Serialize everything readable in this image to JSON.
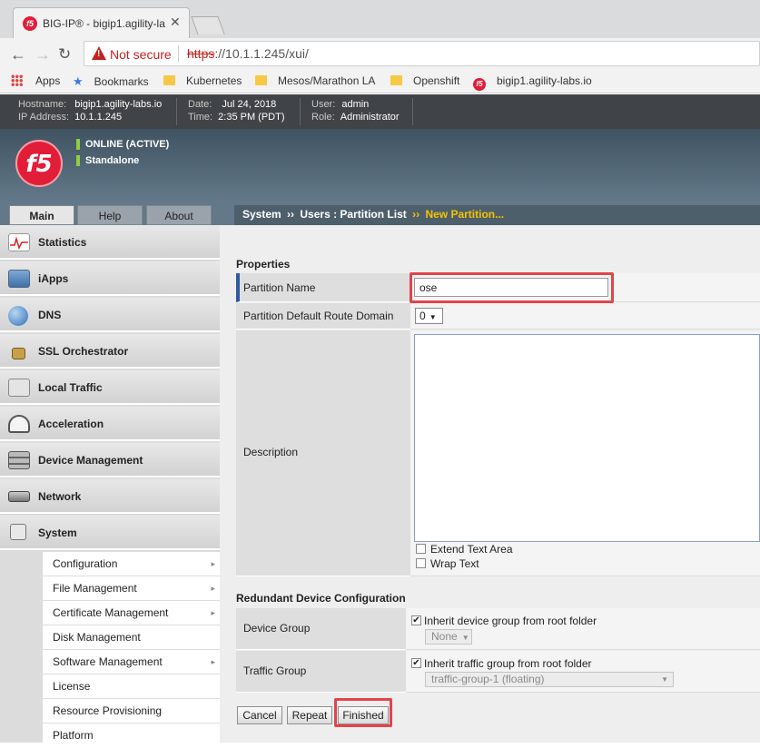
{
  "browser": {
    "tab_title": "BIG-IP® - bigip1.agility-la",
    "url_warning": "Not secure",
    "url_protocol": "https",
    "url_rest": "://10.1.1.245/xui/",
    "bookmarks": [
      "Apps",
      "Bookmarks",
      "Kubernetes",
      "Mesos/Marathon LA",
      "Openshift",
      "bigip1.agility-labs.io"
    ]
  },
  "f5_header": {
    "hostname_label": "Hostname:",
    "hostname": "bigip1.agility-labs.io",
    "ip_label": "IP Address:",
    "ip": "10.1.1.245",
    "date_label": "Date:",
    "date": "Jul 24, 2018",
    "time_label": "Time:",
    "time": "2:35 PM (PDT)",
    "user_label": "User:",
    "user": "admin",
    "role_label": "Role:",
    "role": "Administrator",
    "status_1": "ONLINE (ACTIVE)",
    "status_2": "Standalone",
    "logo_text": "f5",
    "status_color": "#8fcf3c"
  },
  "main_tabs": [
    "Main",
    "Help",
    "About"
  ],
  "breadcrumb": {
    "part1": "System",
    "sep1": "››",
    "part2": "Users : Partition List",
    "sep2": "››",
    "part3": "New Partition..."
  },
  "sidebar": {
    "items": [
      {
        "label": "Statistics",
        "icon": "statistics-icon"
      },
      {
        "label": "iApps",
        "icon": "iapps-icon"
      },
      {
        "label": "DNS",
        "icon": "dns-globe-icon"
      },
      {
        "label": "SSL Orchestrator",
        "icon": "lock-icon"
      },
      {
        "label": "Local Traffic",
        "icon": "local-traffic-icon"
      },
      {
        "label": "Acceleration",
        "icon": "gauge-icon"
      },
      {
        "label": "Device Management",
        "icon": "device-icon"
      },
      {
        "label": "Network",
        "icon": "network-icon"
      },
      {
        "label": "System",
        "icon": "system-icon"
      }
    ],
    "submenu": [
      {
        "label": "Configuration",
        "arrow": "▸"
      },
      {
        "label": "File Management",
        "arrow": "▸"
      },
      {
        "label": "Certificate Management",
        "arrow": "▸"
      },
      {
        "label": "Disk Management",
        "arrow": ""
      },
      {
        "label": "Software Management",
        "arrow": "▸"
      },
      {
        "label": "License",
        "arrow": ""
      },
      {
        "label": "Resource Provisioning",
        "arrow": ""
      },
      {
        "label": "Platform",
        "arrow": ""
      }
    ]
  },
  "form": {
    "properties_title": "Properties",
    "partition_name_label": "Partition Name",
    "partition_name_value": "ose",
    "route_domain_label": "Partition Default Route Domain",
    "route_domain_value": "0",
    "description_label": "Description",
    "extend_text_area": "Extend Text Area",
    "wrap_text": "Wrap Text",
    "redundant_title": "Redundant Device Configuration",
    "device_group_label": "Device Group",
    "device_group_inherit": "Inherit device group from root folder",
    "device_group_value": "None",
    "traffic_group_label": "Traffic Group",
    "traffic_group_inherit": "Inherit traffic group from root folder",
    "traffic_group_value": "traffic-group-1 (floating)",
    "highlight_color": "#e2444c"
  },
  "buttons": {
    "cancel": "Cancel",
    "repeat": "Repeat",
    "finished": "Finished"
  }
}
